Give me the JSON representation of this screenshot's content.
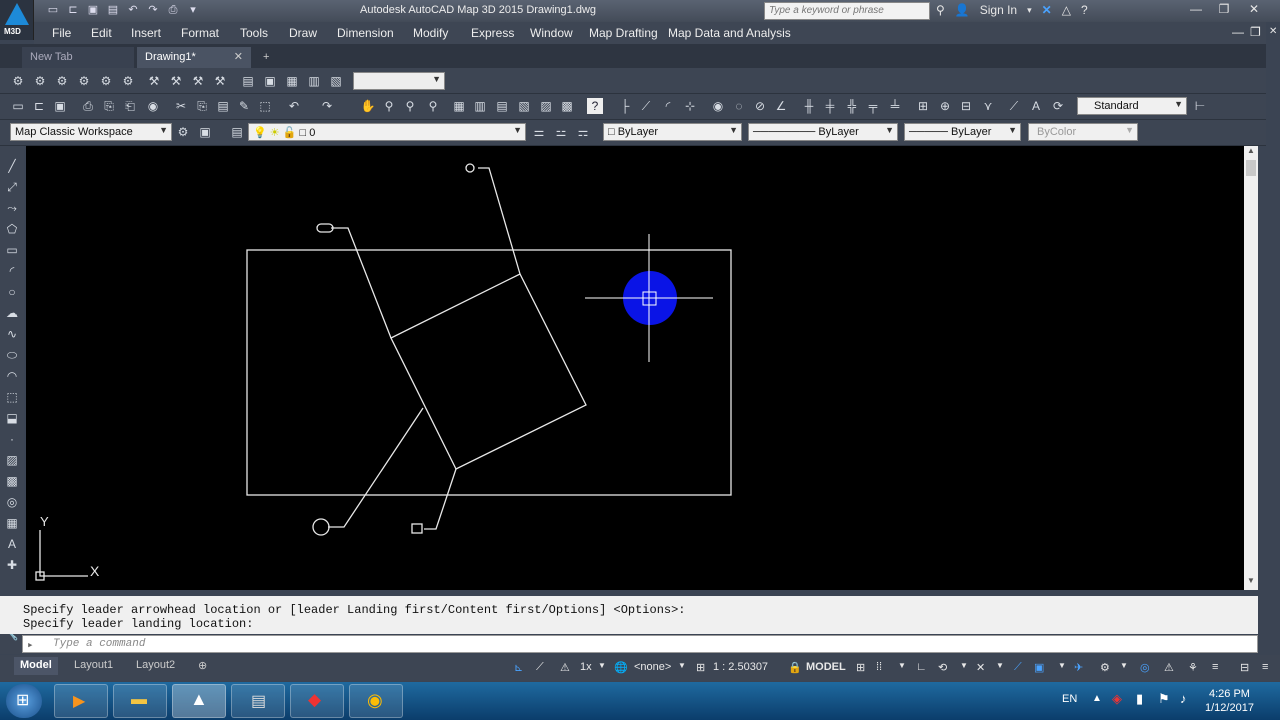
{
  "window": {
    "title": "Autodesk AutoCAD Map 3D 2015    Drawing1.dwg",
    "search_placeholder": "Type a keyword or phrase",
    "sign_in": "Sign In",
    "app_badge": "M3D"
  },
  "menu": [
    "File",
    "Edit",
    "Insert",
    "Format",
    "Tools",
    "Draw",
    "Dimension",
    "Modify",
    "Express",
    "Window",
    "Map Drafting",
    "Map Data and Analysis"
  ],
  "tabs": {
    "items": [
      {
        "label": "New Tab"
      },
      {
        "label": "Drawing1*"
      }
    ],
    "add": "+"
  },
  "toolbars": {
    "workspace": "Map Classic Workspace",
    "layer": "0",
    "color": "ByLayer",
    "linetype": "ByLayer",
    "lineweight": "ByLayer",
    "plotstyle": "ByColor",
    "textstyle": "Standard"
  },
  "ucs": {
    "x_label": "X",
    "y_label": "Y"
  },
  "command": {
    "history": [
      "Specify leader arrowhead location or [leader Landing first/Content first/Options] <Options>:",
      "Specify leader landing location:"
    ],
    "placeholder": "Type a command"
  },
  "status": {
    "layouts": [
      {
        "label": "Model"
      },
      {
        "label": "Layout1"
      },
      {
        "label": "Layout2"
      }
    ],
    "annotation_scale": "1x",
    "coord_system": "<none>",
    "scale": "1 : 2.50307",
    "space": "MODEL"
  },
  "taskbar": {
    "lang": "EN",
    "time": "4:26 PM",
    "date": "1/12/2017"
  },
  "colors": {
    "canvas": "#000000",
    "cursor_highlight": "#0a14e6",
    "lines": "#e8e8e8"
  }
}
